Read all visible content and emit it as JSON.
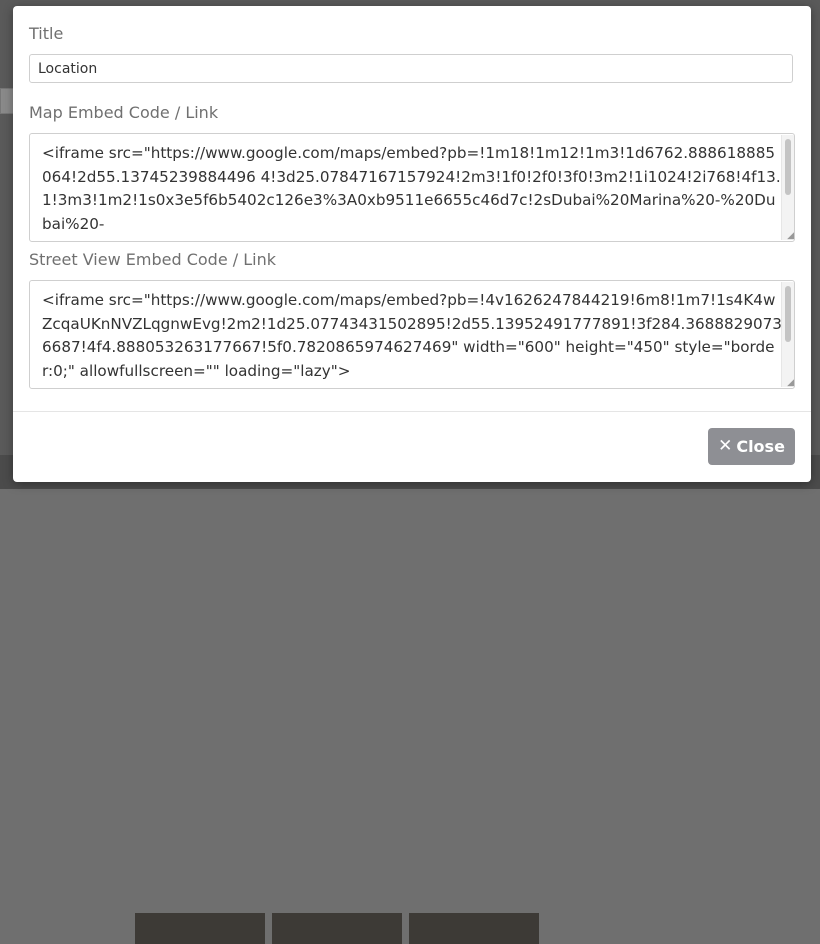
{
  "modal": {
    "title_label": "Title",
    "title_value": "Location",
    "map_label": "Map Embed Code / Link",
    "map_code": "<iframe src=\"https://www.google.com/maps/embed?pb=!1m18!1m12!1m3!1d6762.888618885064!2d55.13745239884496 4!3d25.07847167157924!2m3!1f0!2f0!3f0!3m2!1i1024!2i768!4f13.1!3m3!1m2!1s0x3e5f6b5402c126e3%3A0xb9511e6655c46d7c!2sDubai%20Marina%20-%20Dubai%20-",
    "street_label": "Street View Embed Code / Link",
    "street_code": "<iframe src=\"https://www.google.com/maps/embed?pb=!4v1626247844219!6m8!1m7!1s4K4wZcqaUKnNVZLqgnwEvg!2m2!1d25.07743431502895!2d55.13952491777891!3f284.36888290736687!4f4.888053263177667!5f0.7820865974627469\" width=\"600\" height=\"450\" style=\"border:0;\" allowfullscreen=\"\" loading=\"lazy\">",
    "close_icon": "✕",
    "close_label": "Close"
  }
}
